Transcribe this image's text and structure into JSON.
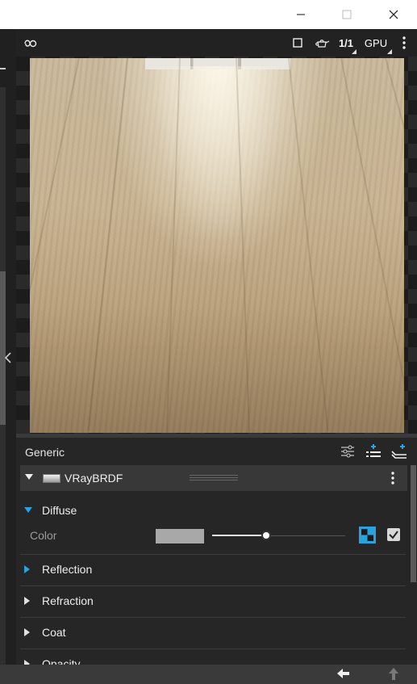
{
  "window": {
    "minimize_icon": "minimize-icon",
    "maximize_icon": "maximize-icon",
    "close_icon": "close-icon"
  },
  "toolbar": {
    "logo_icon": "vray-logo-icon",
    "region_icon": "square-region-icon",
    "teapot_icon": "teapot-icon",
    "ratio_label": "1/1",
    "engine_label": "GPU",
    "more_icon": "kebab-icon"
  },
  "panel": {
    "title": "Generic",
    "icons": [
      "sliders-icon",
      "add-layer-icon",
      "add-stack-icon"
    ],
    "brdf_label": "VRayBRDF",
    "sections": [
      {
        "label": "Diffuse",
        "expanded": true,
        "accent": "#29a3e0"
      },
      {
        "label": "Reflection",
        "expanded": false,
        "accent": "#29a3e0"
      },
      {
        "label": "Refraction",
        "expanded": false,
        "accent": "#e0e0e0"
      },
      {
        "label": "Coat",
        "expanded": false,
        "accent": "#e0e0e0"
      },
      {
        "label": "Opacity",
        "expanded": false,
        "accent": "#e0e0e0"
      }
    ],
    "diffuse": {
      "color_label": "Color",
      "color_swatch": "#a8a8a8",
      "slider_value": 0.4,
      "texture_icon": "checker-texture-icon",
      "enabled": true
    }
  },
  "status": {
    "back_icon": "arrow-left-icon",
    "up_icon": "arrow-up-icon"
  }
}
